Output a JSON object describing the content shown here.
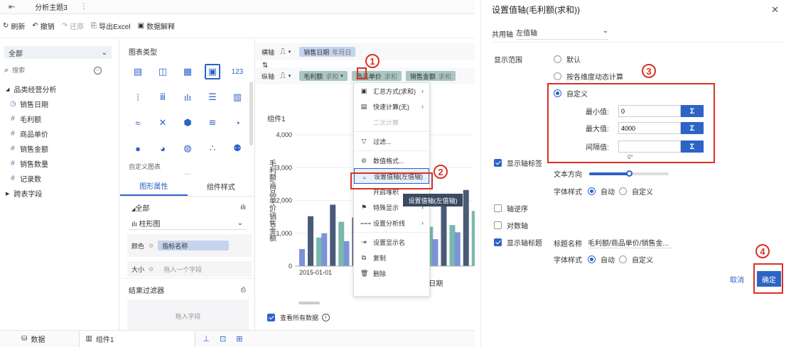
{
  "topbar": {
    "tab_label": "分析主题3"
  },
  "toolbar": {
    "refresh": "刷新",
    "undo": "撤销",
    "redo": "还原",
    "export": "导出Excel",
    "interpret": "数据解释"
  },
  "data_panel": {
    "scope": "全部",
    "search_placeholder": "搜索",
    "group": "品类经营分析",
    "fields": [
      "销售日期",
      "毛利额",
      "商品单价",
      "销售金额",
      "销售数量",
      "记录数"
    ],
    "cross_fields": "跨表字段"
  },
  "prop_panel": {
    "chart_type_title": "图表类型",
    "custom_chart": "自定义图表",
    "tab_graph_attr": "图形属性",
    "tab_component_style": "组件样式",
    "all_label": "全部",
    "chart_kind": "柱形图",
    "color_label": "颜色",
    "color_value": "指标名称",
    "size_label": "大小",
    "size_placeholder": "拖入一个字段",
    "filter_title": "结果过滤器",
    "filter_drop": "拖入字段",
    "icon_123": "123"
  },
  "shelf": {
    "x_label": "横轴",
    "y_label": "纵轴",
    "x_pill": {
      "name": "销售日期",
      "sub": "年月日"
    },
    "y_pills": [
      {
        "name": "毛利额",
        "sub": "求和"
      },
      {
        "name": "商品单价",
        "sub": "求和"
      },
      {
        "name": "销售金额",
        "sub": "求和"
      }
    ]
  },
  "chart": {
    "component_title": "组件1",
    "show_all_data": "查看所有数据"
  },
  "chart_data": {
    "type": "bar",
    "ylabel": "毛利额/商品单价/销售金额",
    "xlabel": "销售日期",
    "yticks": [
      "0",
      "1,000",
      "2,000",
      "3,000",
      "4,000"
    ],
    "xticks": [
      "2015-01-01",
      "2015-01-05"
    ],
    "ylim": [
      0,
      4000
    ],
    "series_colors": [
      "#7b93d8",
      "#4a5b78",
      "#79b8ad"
    ],
    "groups": [
      [
        520,
        1520,
        870
      ],
      [
        1000,
        1870,
        1350
      ],
      [
        760,
        1480,
        1720
      ],
      [
        800,
        2280,
        1600
      ],
      [
        900,
        1950,
        1750
      ],
      [
        1150,
        1700,
        1200
      ],
      [
        820,
        2050,
        1250
      ],
      [
        1030,
        2320,
        1680
      ]
    ]
  },
  "context_menu": {
    "items": [
      {
        "label": "汇总方式(求和)",
        "arrow": true,
        "disabled": false
      },
      {
        "label": "快速计算(无)",
        "arrow": true,
        "disabled": false
      },
      {
        "label": "二次计算",
        "arrow": false,
        "disabled": true
      },
      {
        "label": "过滤...",
        "arrow": false,
        "disabled": false
      },
      {
        "label": "数值格式...",
        "arrow": false,
        "disabled": false
      },
      {
        "label": "设置值轴(左值轴)",
        "arrow": false,
        "disabled": false,
        "highlight": true
      },
      {
        "label": "开启堆积",
        "arrow": false,
        "disabled": false
      },
      {
        "label": "特殊显示",
        "arrow": true,
        "disabled": false
      },
      {
        "label": "设置分析线",
        "arrow": true,
        "disabled": false
      },
      {
        "label": "设置显示名",
        "arrow": false,
        "disabled": false
      },
      {
        "label": "复制",
        "arrow": false,
        "disabled": false
      },
      {
        "label": "删除",
        "arrow": false,
        "disabled": false
      }
    ],
    "tooltip": "设置值轴(左值轴)"
  },
  "status_bar": {
    "data_tab": "数据",
    "component_tab": "组件1"
  },
  "badges": [
    "1",
    "2",
    "3",
    "4"
  ],
  "dialog": {
    "title": "设置值轴(毛利额(求和))",
    "shared_axis_label": "共用轴",
    "shared_axis_value": "左值轴",
    "range_label": "显示范围",
    "range_default": "默认",
    "range_dynamic": "按各维度动态计算",
    "range_custom": "自定义",
    "min_label": "最小值:",
    "min_value": "0",
    "max_label": "最大值:",
    "max_value": "4000",
    "interval_label": "间隔值:",
    "interval_value": "",
    "sigma": "Σ",
    "angle": "0°",
    "show_axis_label": "显示轴标签",
    "text_direction": "文本方向",
    "font_style": "字体样式",
    "auto": "自动",
    "custom": "自定义",
    "reverse_axis": "轴逆序",
    "log_axis": "对数轴",
    "show_axis_title": "显示轴标题",
    "title_name_label": "标题名称",
    "title_name_value": "毛利额/商品单价/销售金...",
    "font_style2": "字体样式",
    "cancel": "取消",
    "confirm": "确定"
  },
  "colors": {
    "accent": "#2c63c7",
    "annotation": "#d93025"
  }
}
